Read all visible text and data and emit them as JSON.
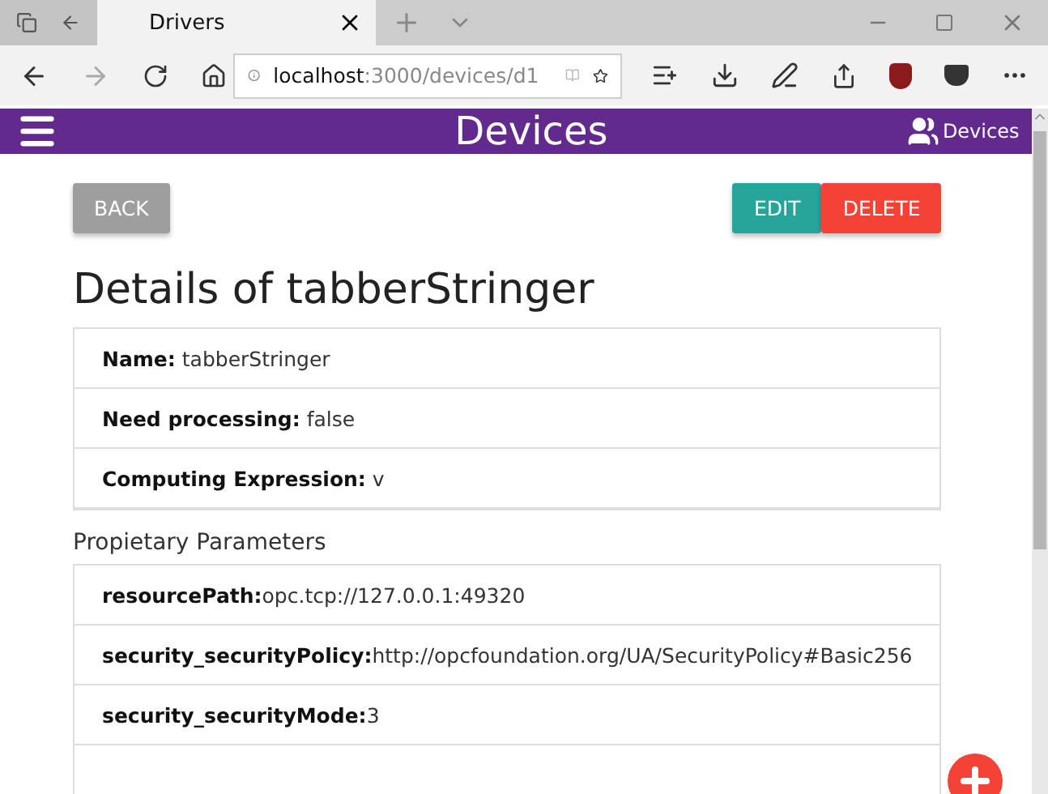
{
  "browser": {
    "tab_title": "Drivers",
    "address": {
      "host": "localhost",
      "path": ":3000/devices/d1"
    }
  },
  "app_bar": {
    "title": "Devices",
    "link": "Devices"
  },
  "actions": [
    {
      "label": "BACK",
      "kind": "back"
    },
    {
      "label": "EDIT",
      "kind": "edit"
    },
    {
      "label": "DELETE",
      "kind": "delete"
    }
  ],
  "heading": "Details of tabberStringer",
  "details": [
    {
      "label": "Name:",
      "value": "tabberStringer"
    },
    {
      "label": "Need processing:",
      "value": "false"
    },
    {
      "label": "Computing Expression:",
      "value": "v"
    }
  ],
  "parameters_title": "Propietary Parameters",
  "parameters": [
    {
      "label": "resourcePath:",
      "value": "opc.tcp://127.0.0.1:49320"
    },
    {
      "label": "security_securityPolicy:",
      "value": "http://opcfoundation.org/UA/SecurityPolicy#Basic256"
    },
    {
      "label": "security_securityMode:",
      "value": "3"
    }
  ]
}
